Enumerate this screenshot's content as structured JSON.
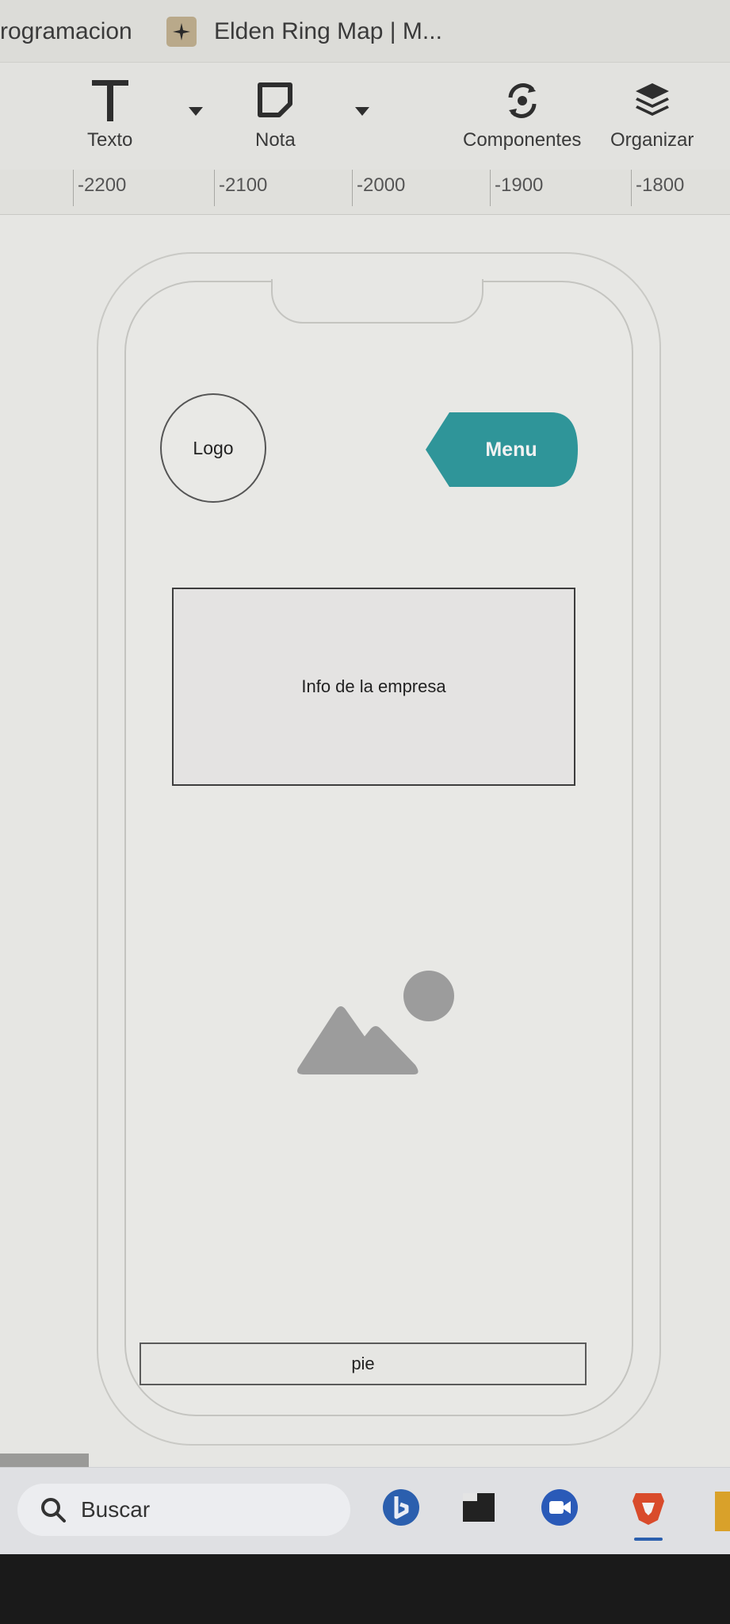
{
  "bookmarks": [
    {
      "label": "rogramacion"
    },
    {
      "label": "Elden Ring Map | M..."
    }
  ],
  "toolbar": {
    "text_label": "Texto",
    "note_label": "Nota",
    "components_label": "Componentes",
    "arrange_label": "Organizar"
  },
  "ruler": {
    "labels": [
      "-2200",
      "-2100",
      "-2000",
      "-1900",
      "-1800"
    ]
  },
  "wireframe": {
    "logo": "Logo",
    "menu": "Menu",
    "info": "Info de la empresa",
    "footer": "pie"
  },
  "taskbar": {
    "search_placeholder": "Buscar"
  },
  "colors": {
    "menu_accent": "#2f9599",
    "image_placeholder": "#9c9c9c",
    "brave_red": "#d94b2b",
    "bing_blue": "#2b5fae"
  }
}
